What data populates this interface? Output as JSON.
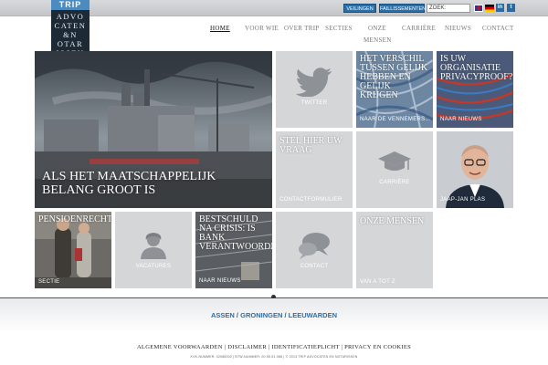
{
  "topbar": {
    "veilingen": "VEILINGEN",
    "faillissementen": "FAILLISSEMENTEN",
    "search_placeholder": "ZOEK:",
    "social": {
      "linkedin": "in",
      "twitter": "t"
    }
  },
  "logo": {
    "brand": "TRIP",
    "lines": [
      "ADVO",
      "CATEN",
      "&N",
      "OTAR",
      "ISSEN"
    ]
  },
  "nav": {
    "items": [
      {
        "label": "HOME"
      },
      {
        "label": "VOOR WIE"
      },
      {
        "label": "OVER TRIP"
      },
      {
        "label": "SECTIES"
      },
      {
        "label": "ONZE"
      },
      {
        "label": "MENSEN"
      },
      {
        "label": "CARRIÈRE"
      },
      {
        "label": "NIEUWS"
      },
      {
        "label": "CONTACT"
      }
    ]
  },
  "tiles": {
    "hero": {
      "title": "ALS HET MAATSCHAPPELIJK BELANG GROOT IS"
    },
    "twitter": {
      "caption": "TWITTER"
    },
    "verschil": {
      "title": "HET VERSCHIL TUSSEN GELIJK HEBBEN EN GELIJK KRIJGEN",
      "caption": "NAAR DE VENNEMERS..."
    },
    "organisatie": {
      "title": "IS UW ORGANISATIE PRIVACYPROOF?",
      "caption": "NAAR NIEUWS"
    },
    "vraag": {
      "title": "STEL HIER UW VRAAG",
      "caption": "CONTACTFORMULIER"
    },
    "carriere": {
      "caption": "CARRIÈRE"
    },
    "person": {
      "caption": "JAAP-JAN PLAS"
    },
    "pensioen": {
      "title": "PENSIOENRECHT",
      "caption": "SECTIE"
    },
    "vacatures": {
      "caption": "VACATURES"
    },
    "bestschuld": {
      "title": "BESTSCHULD NA CRISIS: IS BANK VERANTWOORDELIJK?",
      "caption": "NAAR NIEUWS"
    },
    "contact": {
      "caption": "CONTACT"
    },
    "mensen": {
      "title": "ONZE MENSEN",
      "caption": "VAN A TOT Z"
    }
  },
  "footer": {
    "cities": [
      "ASSEN",
      "GRONINGEN",
      "LEEUWARDEN"
    ],
    "separator": "/",
    "links": [
      "ALGEMENE VOORWAARDEN",
      "DISCLAIMER",
      "IDENTIFICATIEPLICHT",
      "PRIVACY EN COOKIES"
    ],
    "link_separator": "|",
    "fine_print": "KVK-NUMMER: 02088302 | BTW-NUMMER: 00.55.51.086 | © 2013 TRIP ADVOCATEN EN NOTARISSEN"
  },
  "colors": {
    "accent": "#2a6fa8",
    "tile_gray": "#d4d6d8",
    "logo_dark": "#1d2a36"
  }
}
